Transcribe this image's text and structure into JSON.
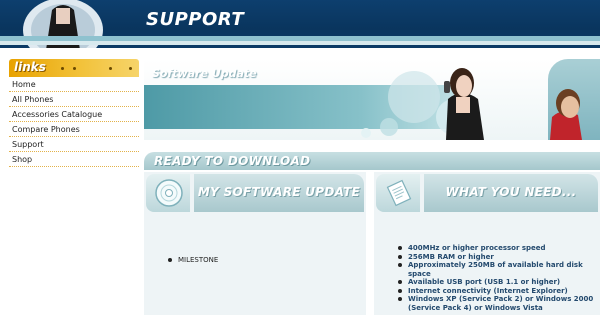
{
  "header": {
    "title": "SUPPORT"
  },
  "sidebar": {
    "heading": "links",
    "items": [
      {
        "label": "Home"
      },
      {
        "label": "All Phones"
      },
      {
        "label": "Accessories Catalogue"
      },
      {
        "label": "Compare Phones"
      },
      {
        "label": "Support"
      },
      {
        "label": "Shop"
      }
    ]
  },
  "banner": {
    "label": "Software Update"
  },
  "ready": {
    "title": "READY TO DOWNLOAD"
  },
  "panels": {
    "left": {
      "title": "MY SOFTWARE UPDATE",
      "item": "MILESTONE",
      "icon": "cd-disc-icon"
    },
    "right": {
      "title": "WHAT YOU NEED...",
      "icon": "document-icon",
      "requirements": [
        "400MHz or higher processor speed",
        "256MB RAM or higher",
        "Approximately 250MB of available hard disk space",
        "Available USB port (USB 1.1 or higher)",
        "Internet connectivity (Internet Explorer)",
        "Windows XP (Service Pack 2) or Windows 2000 (Service Pack 4) or Windows Vista"
      ]
    }
  },
  "colors": {
    "header": "#0d3f6e",
    "accent": "#8fc2cf",
    "links": "#f2c23a",
    "panel": "#eef4f6"
  }
}
